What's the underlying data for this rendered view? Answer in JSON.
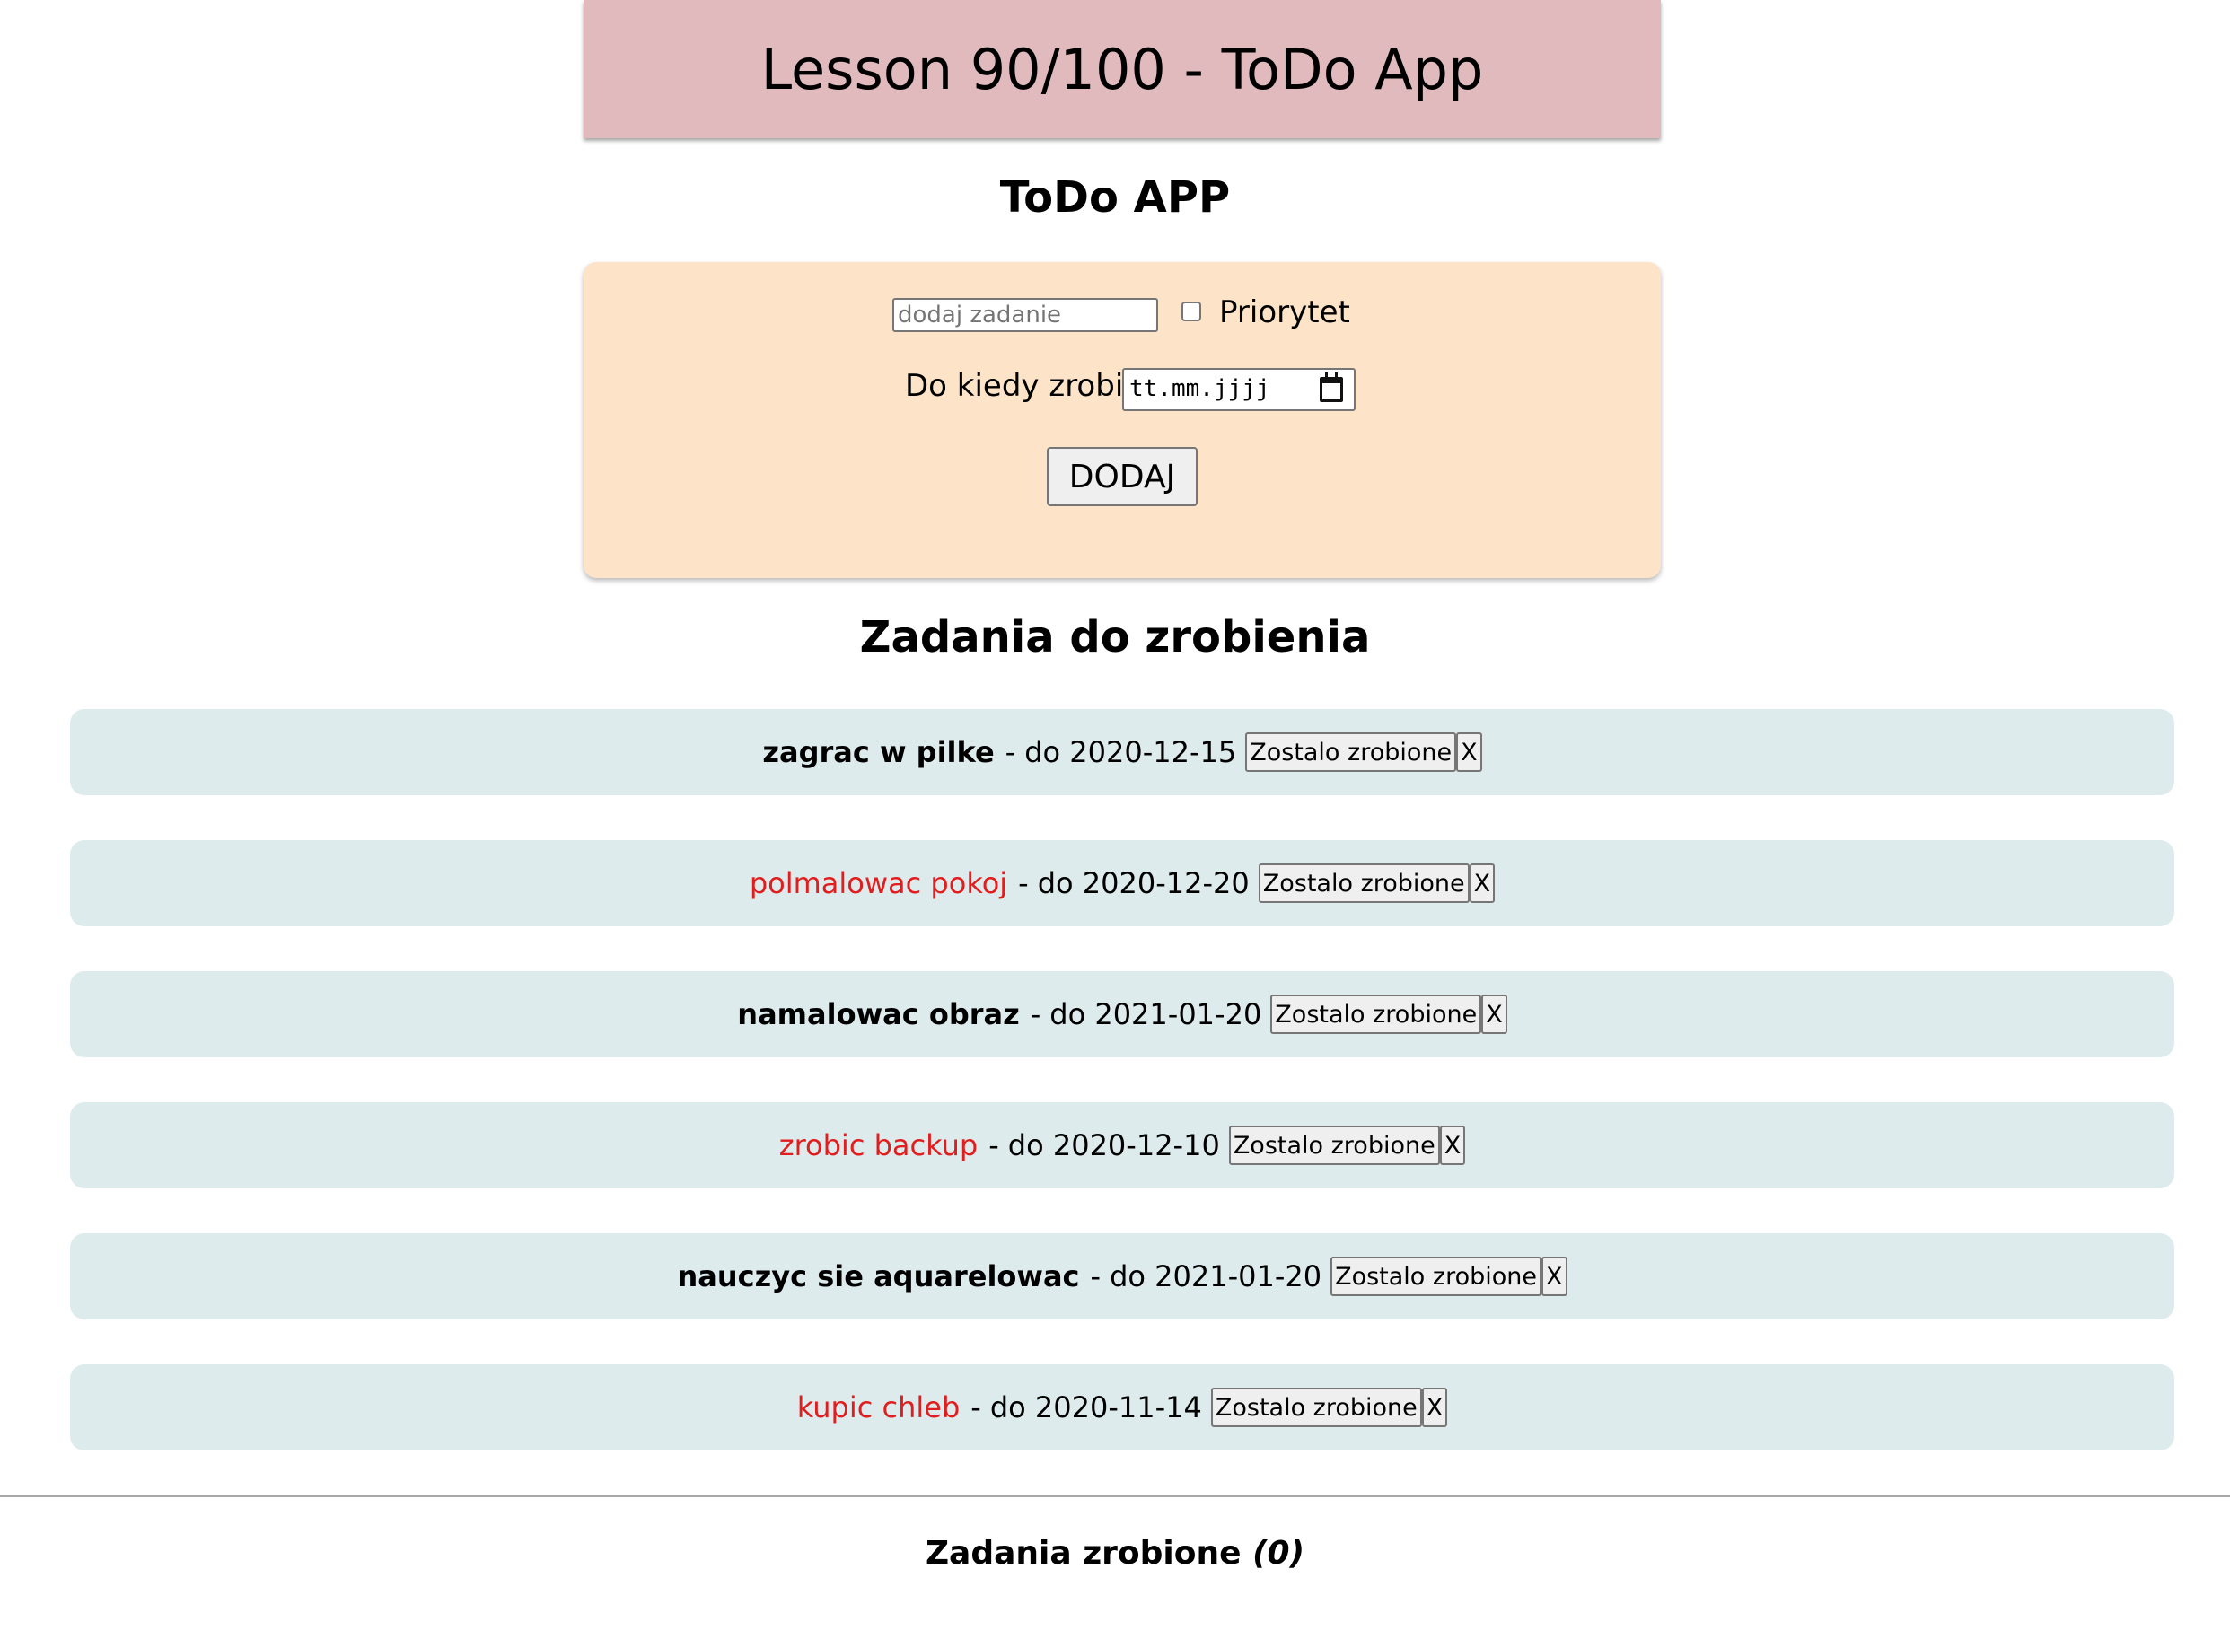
{
  "header": {
    "banner_title": "Lesson 90/100 - ToDo App",
    "app_title": "ToDo APP"
  },
  "form": {
    "task_input": {
      "value": "",
      "placeholder": "dodaj zadanie"
    },
    "priority": {
      "label": "Priorytet",
      "checked": false
    },
    "deadline": {
      "label": "Do kiedy zrobic",
      "placeholder": "tt.mm.jjjj"
    },
    "add_button": "DODAJ"
  },
  "todo_section": {
    "heading": "Zadania do zrobienia",
    "items": [
      {
        "name": "zagrac w pilke",
        "separator": "-",
        "date_text": "do 2020-12-15",
        "priority": false,
        "done_label": "Zostalo zrobione",
        "delete_label": "X"
      },
      {
        "name": "polmalowac pokoj",
        "separator": "-",
        "date_text": "do 2020-12-20",
        "priority": true,
        "done_label": "Zostalo zrobione",
        "delete_label": "X"
      },
      {
        "name": "namalowac obraz",
        "separator": "-",
        "date_text": "do 2021-01-20",
        "priority": false,
        "done_label": "Zostalo zrobione",
        "delete_label": "X"
      },
      {
        "name": "zrobic backup",
        "separator": "-",
        "date_text": "do 2020-12-10",
        "priority": true,
        "done_label": "Zostalo zrobione",
        "delete_label": "X"
      },
      {
        "name": "nauczyc sie aquarelowac",
        "separator": "-",
        "date_text": "do 2021-01-20",
        "priority": false,
        "done_label": "Zostalo zrobione",
        "delete_label": "X"
      },
      {
        "name": "kupic chleb",
        "separator": "-",
        "date_text": "do 2020-11-14",
        "priority": true,
        "done_label": "Zostalo zrobione",
        "delete_label": "X"
      }
    ]
  },
  "done_section": {
    "heading": "Zadania zrobione",
    "count": "(0)"
  },
  "colors": {
    "banner_bg": "#e0babd",
    "form_bg": "#fde3c8",
    "task_row_bg": "#deebed",
    "priority_text": "#e11d1d"
  },
  "icons": {
    "date_picker": "calendar-icon"
  }
}
